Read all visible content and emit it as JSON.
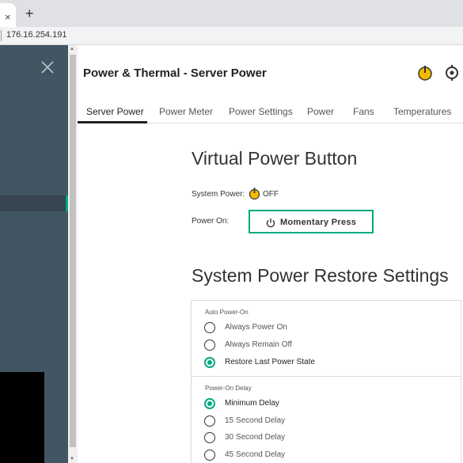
{
  "browser": {
    "tab_close_glyph": "×",
    "new_tab_glyph": "+",
    "address": "176.16.254.191"
  },
  "sidenav": {
    "close_glyph": "×",
    "accent_color": "#01a982"
  },
  "header": {
    "title": "Power & Thermal - Server Power"
  },
  "tabs": [
    {
      "label": "Server Power",
      "active": true
    },
    {
      "label": "Power Meter",
      "active": false
    },
    {
      "label": "Power Settings",
      "active": false
    },
    {
      "label": "Power",
      "active": false
    },
    {
      "label": "Fans",
      "active": false
    },
    {
      "label": "Temperatures",
      "active": false
    }
  ],
  "virtual_power": {
    "title": "Virtual Power Button",
    "system_power_label": "System Power:",
    "system_power_state": "OFF",
    "power_on_label": "Power On:",
    "button_label": "Momentary Press"
  },
  "restore": {
    "title": "System Power Restore Settings",
    "auto_power_on": {
      "label": "Auto Power-On",
      "options": [
        {
          "label": "Always Power On",
          "checked": false
        },
        {
          "label": "Always Remain Off",
          "checked": false
        },
        {
          "label": "Restore Last Power State",
          "checked": true
        }
      ]
    },
    "power_on_delay": {
      "label": "Power-On Delay",
      "options": [
        {
          "label": "Minimum Delay",
          "checked": true
        },
        {
          "label": "15 Second Delay",
          "checked": false
        },
        {
          "label": "30 Second Delay",
          "checked": false
        },
        {
          "label": "45 Second Delay",
          "checked": false
        }
      ]
    }
  },
  "colors": {
    "accent": "#01a982",
    "power_icon": "#f5b800",
    "nav_bg": "#425563"
  }
}
